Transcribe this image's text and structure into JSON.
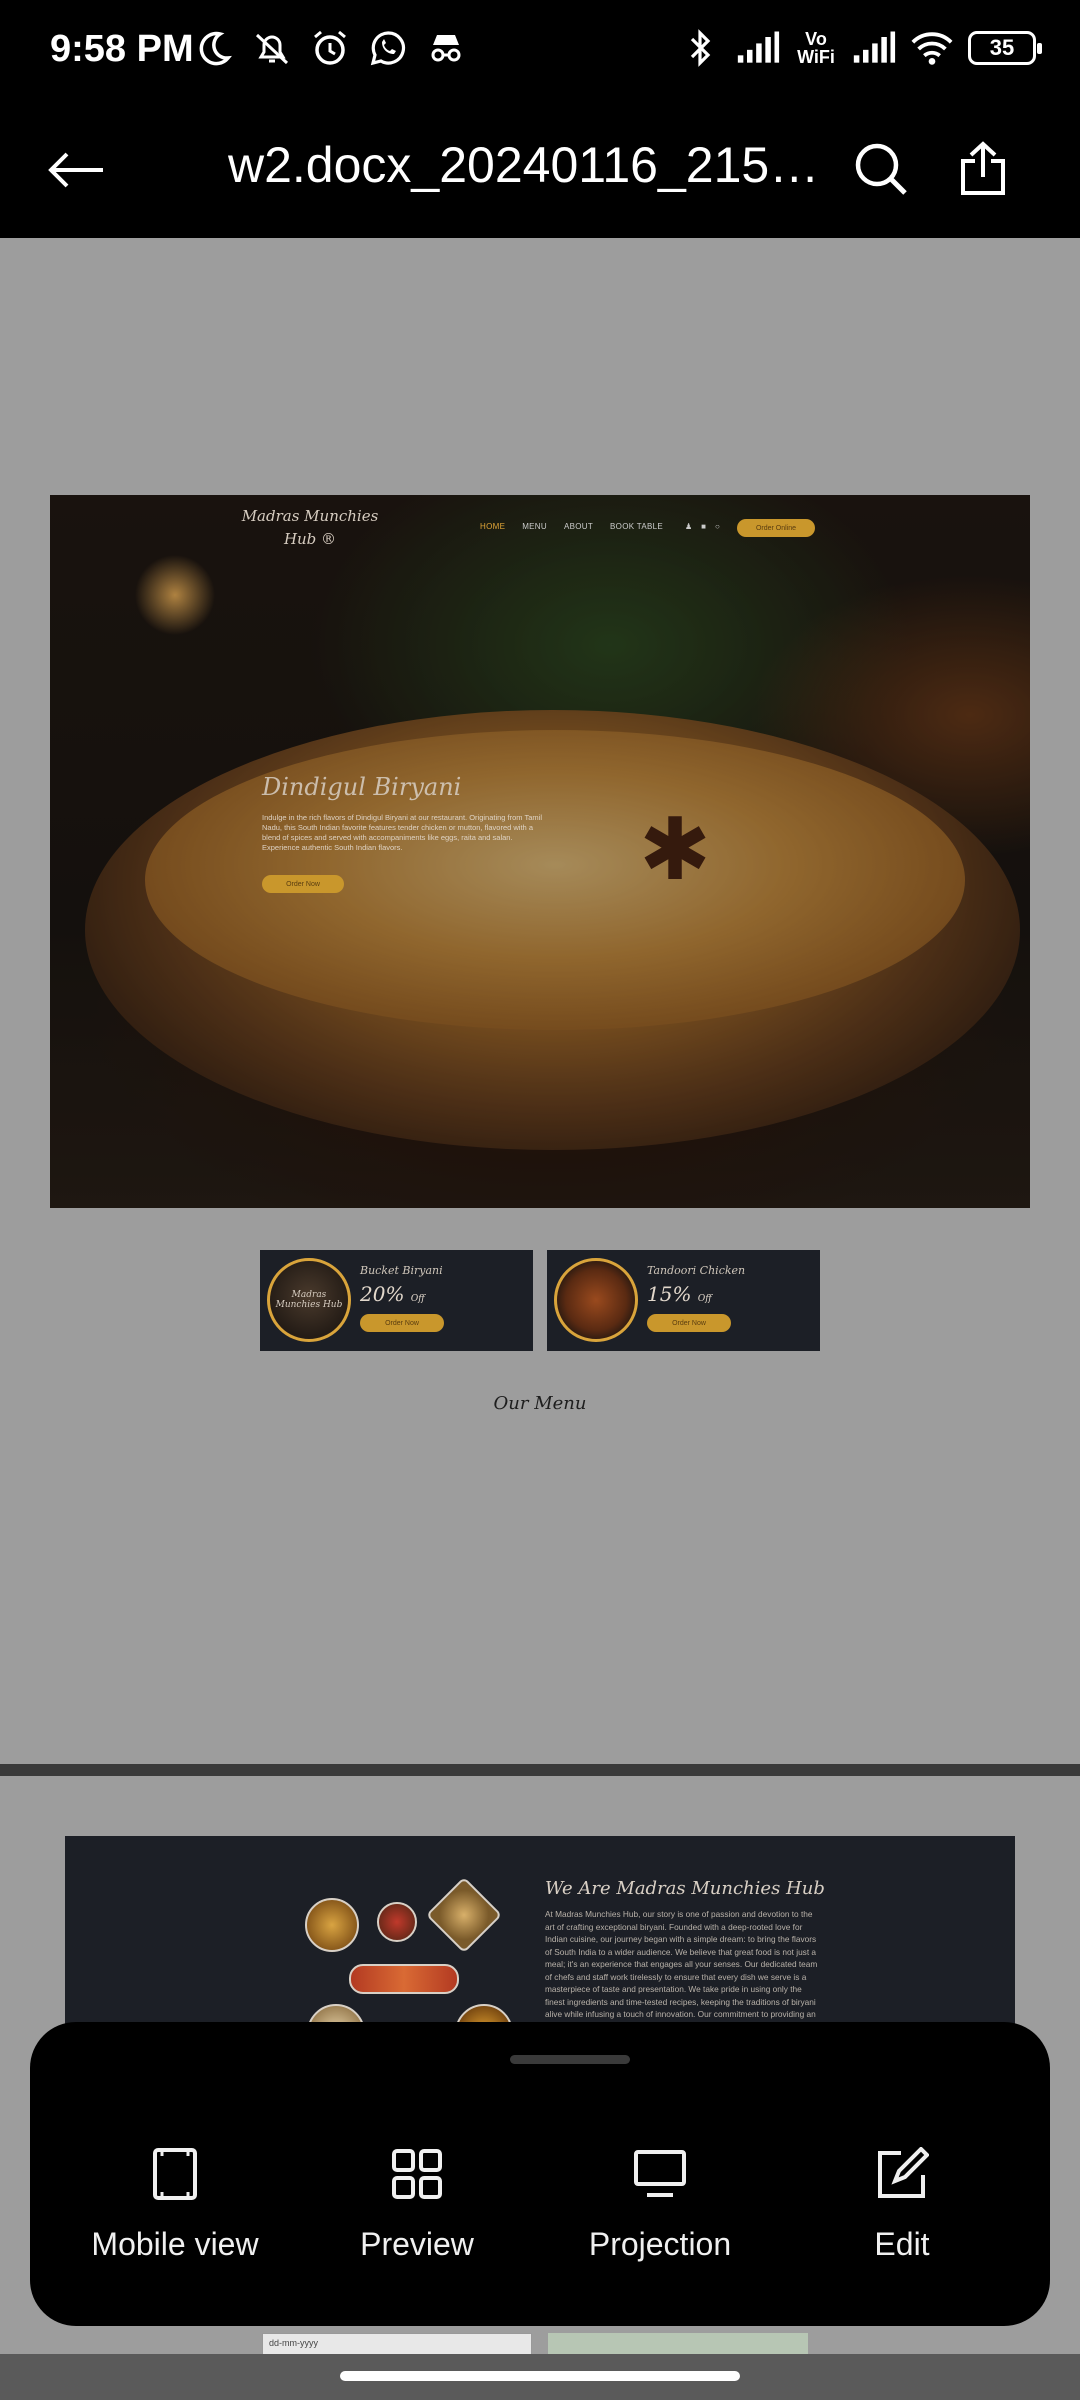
{
  "status_bar": {
    "time": "9:58 PM",
    "battery": "35",
    "vowifi_line1": "Vo",
    "vowifi_line2": "WiFi",
    "icons_left": [
      "moon-icon",
      "bell-off-icon",
      "alarm-icon",
      "whatsapp-icon",
      "incognito-icon"
    ],
    "icons_right": [
      "bluetooth-icon",
      "signal-icon",
      "vowifi-icon",
      "signal-icon",
      "wifi-icon",
      "battery-icon"
    ]
  },
  "app_bar": {
    "title": "w2.docx_20240116_2155..."
  },
  "document": {
    "hero": {
      "logo": "Madras Munchies Hub ®",
      "nav": [
        "HOME",
        "MENU",
        "ABOUT",
        "BOOK TABLE"
      ],
      "order_button": "Order Online",
      "heading": "Dindigul Biryani",
      "body": "Indulge in the rich flavors of Dindigul Biryani at our restaurant. Originating from Tamil Nadu, this South Indian favorite features tender chicken or mutton, flavored with a blend of spices and served with accompaniments like eggs, raita and salan. Experience authentic South Indian flavors.",
      "button": "Order Now"
    },
    "offers": [
      {
        "name": "Bucket Biryani",
        "percent": "20%",
        "suffix": "Off",
        "button": "Order Now",
        "image_text": "Madras Munchies Hub"
      },
      {
        "name": "Tandoori Chicken",
        "percent": "15%",
        "suffix": "Off",
        "button": "Order Now",
        "image_text": ""
      }
    ],
    "menu_heading": "Our Menu",
    "about": {
      "title": "We Are Madras Munchies Hub",
      "text": "At Madras Munchies Hub, our story is one of passion and devotion to the art of crafting exceptional biryani. Founded with a deep-rooted love for Indian cuisine, our journey began with a simple dream: to bring the flavors of South India to a wider audience. We believe that great food is not just a meal; it's an experience that engages all your senses. Our dedicated team of chefs and staff work tirelessly to ensure that every dish we serve is a masterpiece of taste and presentation. We take pride in using only the finest ingredients and time-tested recipes, keeping the traditions of biryani alive while infusing a touch of innovation. Our commitment to providing an exquisite dining experience is unwavering, and we invite you"
    },
    "peek_field": "dd-mm-yyyy"
  },
  "action_sheet": {
    "items": [
      {
        "label": "Mobile view",
        "icon": "mobile-view-icon"
      },
      {
        "label": "Preview",
        "icon": "grid-icon"
      },
      {
        "label": "Projection",
        "icon": "monitor-icon"
      },
      {
        "label": "Edit",
        "icon": "edit-icon"
      }
    ]
  },
  "colors": {
    "accent_gold": "#c9972c",
    "card_dark": "#1c1f26",
    "page_gray": "#9d9d9d"
  }
}
